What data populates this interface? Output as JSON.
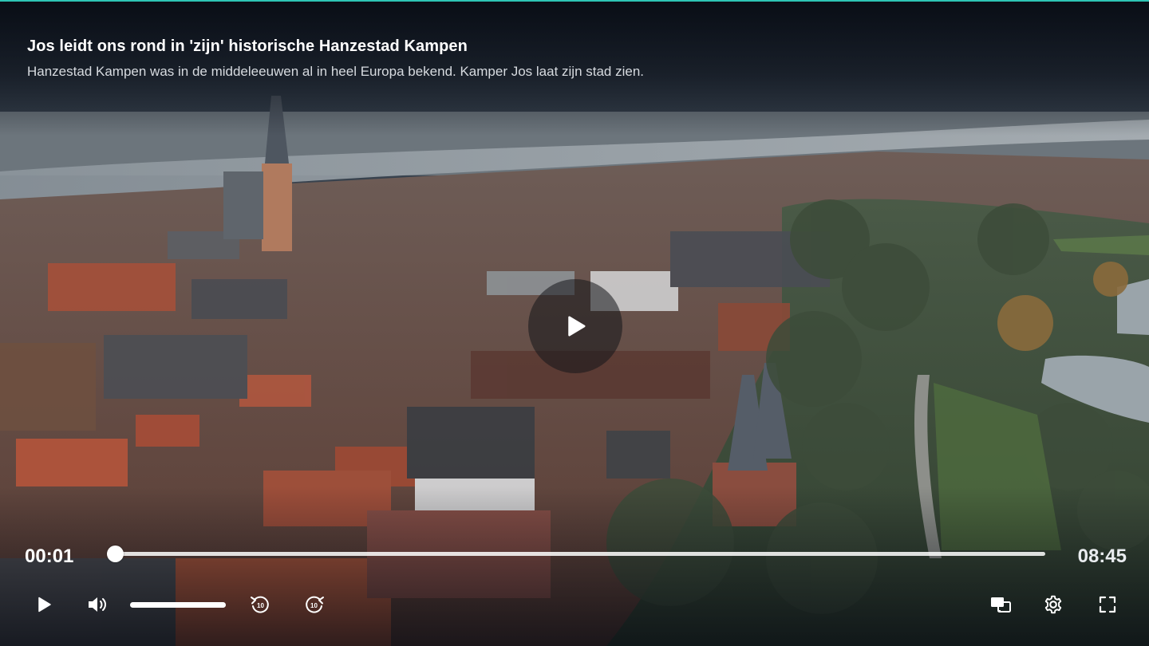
{
  "video": {
    "title": "Jos leidt ons rond in 'zijn' historische Hanzestad Kampen",
    "subtitle": "Hanzestad Kampen was in de middeleeuwen al in heel Europa bekend. Kamper Jos laat zijn stad zien."
  },
  "playback": {
    "current_time": "00:01",
    "total_time": "08:45",
    "progress_fraction": 0.002,
    "volume_fraction": 1.0
  },
  "controls": {
    "play_icon": "play-icon",
    "volume_icon": "speaker-icon",
    "rewind_icon": "rewind-10-icon",
    "rewind_label": "10",
    "forward_icon": "forward-10-icon",
    "forward_label": "10",
    "cast_icon": "cast-icon",
    "settings_icon": "gear-icon",
    "fullscreen_icon": "fullscreen-icon"
  },
  "colors": {
    "accent_line": "#2ec4b6",
    "control_white": "#ffffff"
  }
}
